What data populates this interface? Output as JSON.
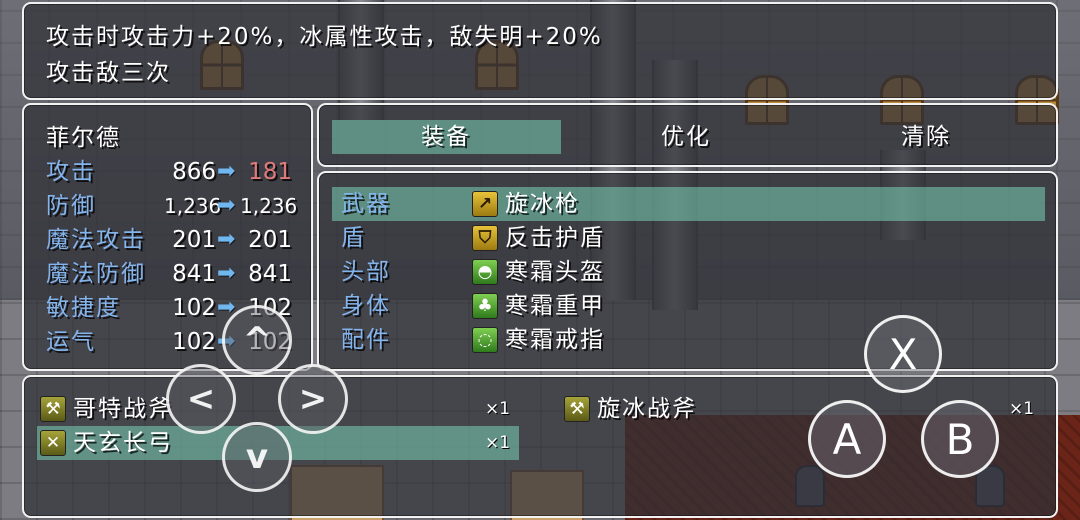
{
  "help": {
    "line1": "攻击时攻击力+20%，冰属性攻击，敌失明+20%",
    "line2": "攻击敌三次"
  },
  "status": {
    "actor_name": "菲尔德",
    "params": [
      {
        "label": "攻击",
        "current": "866",
        "new": "181",
        "new_down": true
      },
      {
        "label": "防御",
        "current": "1,236",
        "new": "1,236",
        "new_down": false
      },
      {
        "label": "魔法攻击",
        "current": "201",
        "new": "201",
        "new_down": false
      },
      {
        "label": "魔法防御",
        "current": "841",
        "new": "841",
        "new_down": false
      },
      {
        "label": "敏捷度",
        "current": "102",
        "new": "102",
        "new_down": false
      },
      {
        "label": "运气",
        "current": "102",
        "new": "102",
        "new_down": false
      }
    ],
    "arrow_glyph": "➡"
  },
  "commands": [
    "装备",
    "优化",
    "清除"
  ],
  "selected_command": 0,
  "slots": [
    {
      "slot": "武器",
      "item": "旋冰枪",
      "icon": "spear-icon",
      "glyph": "↗",
      "icon_color": "yellow"
    },
    {
      "slot": "盾",
      "item": "反击护盾",
      "icon": "shield-icon",
      "glyph": "⛉",
      "icon_color": "yellow"
    },
    {
      "slot": "头部",
      "item": "寒霜头盔",
      "icon": "helmet-icon",
      "glyph": "◓",
      "icon_color": "green"
    },
    {
      "slot": "身体",
      "item": "寒霜重甲",
      "icon": "armor-icon",
      "glyph": "♣",
      "icon_color": "green"
    },
    {
      "slot": "配件",
      "item": "寒霜戒指",
      "icon": "ring-icon",
      "glyph": "◌",
      "icon_color": "green"
    }
  ],
  "selected_slot": 0,
  "items": [
    {
      "name": "哥特战斧",
      "count": "×1",
      "icon": "axe-icon",
      "glyph": "⚒"
    },
    {
      "name": "旋冰战斧",
      "count": "×1",
      "icon": "axe-icon",
      "glyph": "⚒"
    },
    {
      "name": "天玄长弓",
      "count": "×1",
      "icon": "bow-icon",
      "glyph": "✕"
    }
  ],
  "selected_item": 2,
  "controller": {
    "dpad": {
      "up": "^",
      "left": "<",
      "right": ">",
      "down": "v"
    },
    "buttons": {
      "x": "X",
      "a": "A",
      "b": "B"
    }
  },
  "colors": {
    "label_blue": "#84b4ec",
    "stat_down_red": "#e07a7a",
    "arrow_blue": "#6fb7ee",
    "highlight_teal": "#78d2b4",
    "window_border": "#f2f2f2"
  }
}
